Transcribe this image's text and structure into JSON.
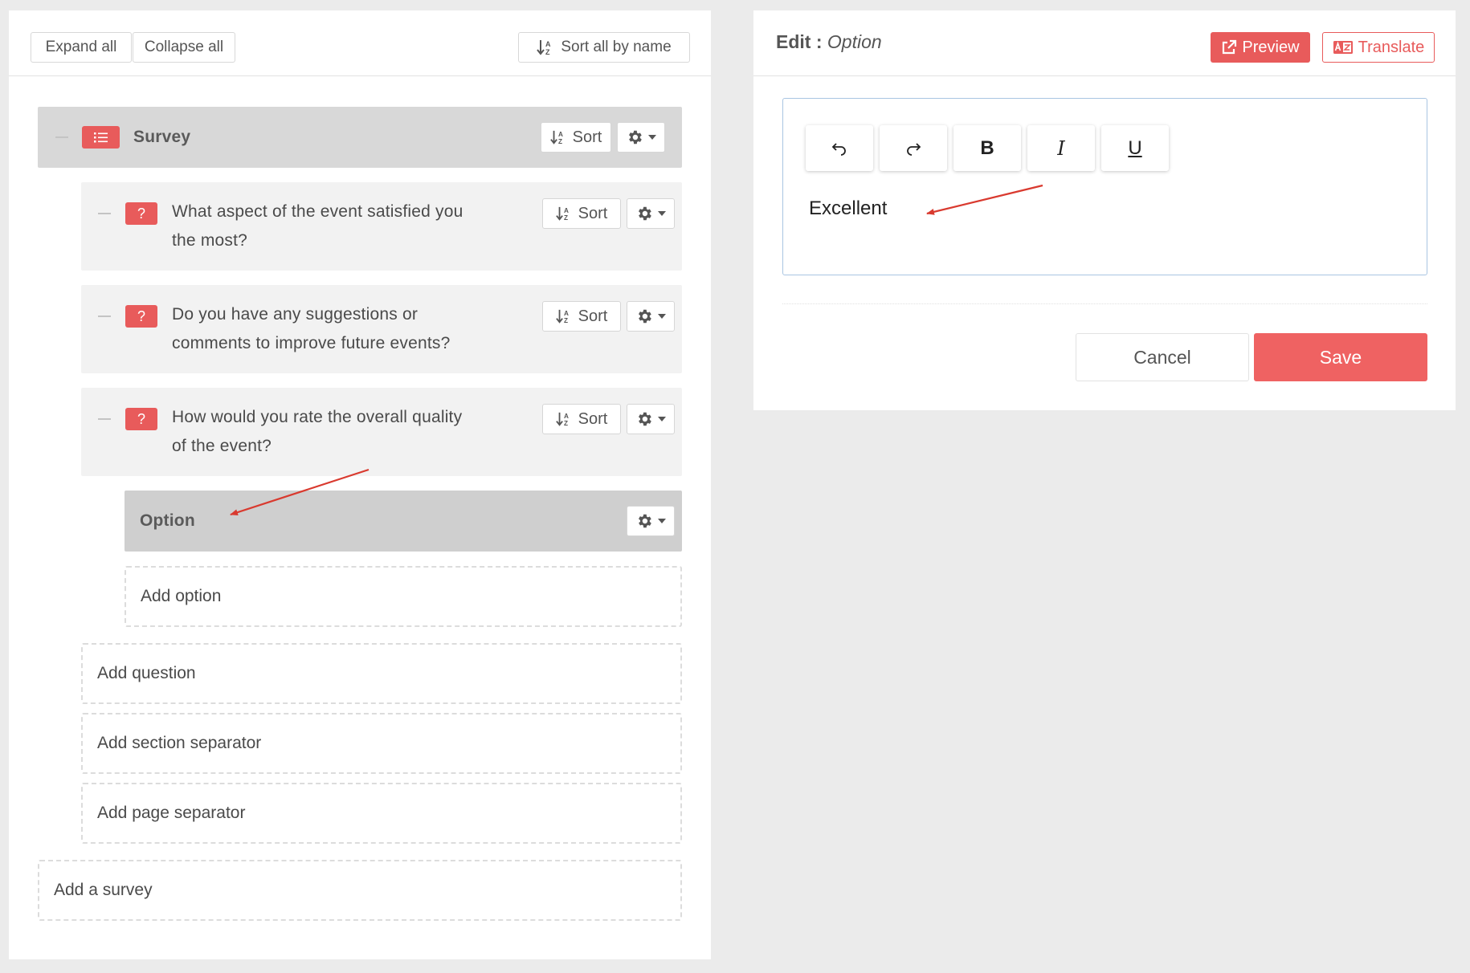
{
  "toolbar": {
    "expand_all": "Expand all",
    "collapse_all": "Collapse all",
    "sort_all_by_name": "Sort all by name"
  },
  "tree": {
    "survey": {
      "title": "Survey",
      "sort_label": "Sort",
      "icon": "list-icon"
    },
    "questions": [
      {
        "text": "What aspect of the event satisfied you the most?",
        "line1": "What aspect of the event satisfied you",
        "line2": "the most?",
        "badge": "?",
        "sort_label": "Sort"
      },
      {
        "text": "Do you have any suggestions or comments to improve future events?",
        "line1": "Do you have any suggestions or",
        "line2": "comments to improve future events?",
        "badge": "?",
        "sort_label": "Sort"
      },
      {
        "text": "How would you rate the overall quality of the event?",
        "line1": "How would you rate the overall quality",
        "line2": "of the event?",
        "badge": "?",
        "sort_label": "Sort"
      }
    ],
    "option": {
      "title": "Option"
    },
    "add_option": "Add option",
    "add_question": "Add question",
    "add_section_separator": "Add section separator",
    "add_page_separator": "Add page separator",
    "add_survey": "Add a survey"
  },
  "edit_panel": {
    "label": "Edit :",
    "item_name": "Option",
    "preview": "Preview",
    "translate": "Translate",
    "editor": {
      "undo_icon": "undo-icon",
      "redo_icon": "redo-icon",
      "bold": "B",
      "italic": "I",
      "underline": "U",
      "content": "Excellent"
    },
    "cancel": "Cancel",
    "save": "Save"
  },
  "colors": {
    "accent": "#e85b5b",
    "save": "#ef6262",
    "editor_border": "#a9c5e2",
    "annotation_arrow": "#d93a2f"
  }
}
